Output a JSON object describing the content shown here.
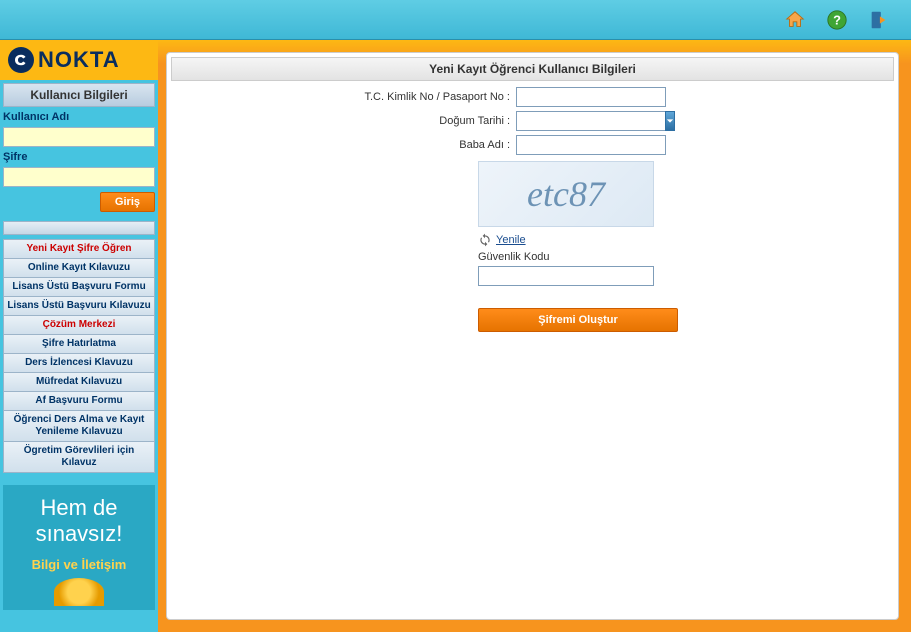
{
  "topbar": {
    "home_icon": "home-icon",
    "help_icon": "help-icon",
    "exit_icon": "exit-icon"
  },
  "logo": {
    "text": "NOKTA"
  },
  "sidebar": {
    "login_header": "Kullanıcı Bilgileri",
    "username_label": "Kullanıcı Adı",
    "username_value": "",
    "password_label": "Şifre",
    "password_value": "",
    "login_button": "Giriş",
    "menu": [
      {
        "label": "Yeni Kayıt Şifre Öğren",
        "red": true
      },
      {
        "label": "Online Kayıt Kılavuzu",
        "red": false
      },
      {
        "label": "Lisans Üstü Başvuru Formu",
        "red": false
      },
      {
        "label": "Lisans Üstü Başvuru Kılavuzu",
        "red": false
      },
      {
        "label": "Çözüm Merkezi",
        "red": true
      },
      {
        "label": "Şifre Hatırlatma",
        "red": false
      },
      {
        "label": "Ders İzlencesi Klavuzu",
        "red": false
      },
      {
        "label": "Müfredat Kılavuzu",
        "red": false
      },
      {
        "label": "Af Başvuru Formu",
        "red": false
      },
      {
        "label": "Öğrenci Ders Alma ve Kayıt Yenileme Kılavuzu",
        "red": false
      },
      {
        "label": "Ögretim Görevlileri için Kılavuz",
        "red": false
      }
    ],
    "promo": {
      "line1": "Hem de",
      "line2": "sınavsız!",
      "line3": "Bilgi ve İletişim"
    }
  },
  "form": {
    "title": "Yeni Kayıt Öğrenci Kullanıcı Bilgileri",
    "tc_label": "T.C. Kimlik No / Pasaport No :",
    "tc_value": "",
    "dob_label": "Doğum Tarihi :",
    "dob_value": "",
    "father_label": "Baba Adı :",
    "father_value": "",
    "captcha_text": "etc87",
    "refresh_label": "Yenile",
    "security_label": "Güvenlik Kodu",
    "security_value": "",
    "submit_label": "Şifremi Oluştur"
  }
}
